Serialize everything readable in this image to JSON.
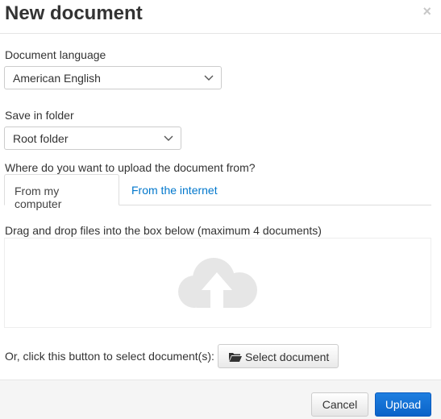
{
  "dialog": {
    "title": "New document",
    "close_symbol": "×"
  },
  "language": {
    "label": "Document language",
    "selected": "American English"
  },
  "folder": {
    "label": "Save in folder",
    "selected": "Root folder"
  },
  "upload_source": {
    "question": "Where do you want to upload the document from?",
    "tabs": [
      {
        "label": "From my computer",
        "active": true
      },
      {
        "label": "From the internet",
        "active": false
      }
    ]
  },
  "dropzone": {
    "instructions": "Drag and drop files into the box below (maximum 4 documents)",
    "icon": "cloud-upload-icon"
  },
  "select": {
    "prompt": "Or, click this button to select document(s):",
    "button_label": "Select document",
    "icon": "folder-open-icon"
  },
  "footer": {
    "cancel_label": "Cancel",
    "upload_label": "Upload"
  },
  "colors": {
    "primary_button": "#0a63c8",
    "link": "#0077cc",
    "cloud_icon": "#e5e5e5"
  }
}
